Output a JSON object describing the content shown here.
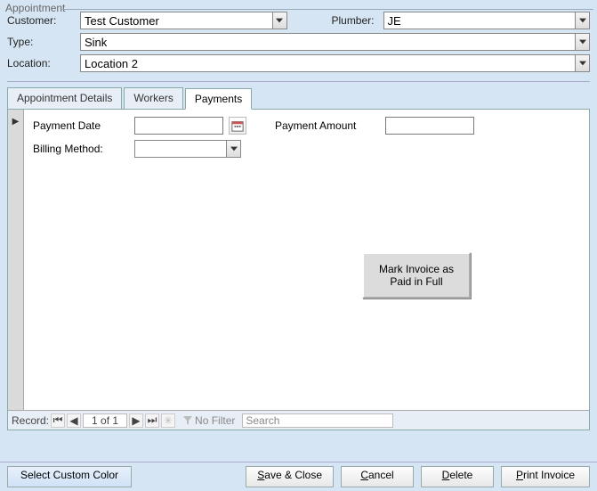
{
  "window_title": "Appointment",
  "header": {
    "customer_label": "Customer:",
    "customer_value": "Test Customer",
    "plumber_label": "Plumber:",
    "plumber_value": "JE",
    "type_label": "Type:",
    "type_value": "Sink",
    "location_label": "Location:",
    "location_value": "Location 2"
  },
  "tabs": {
    "t0": "Appointment Details",
    "t1": "Workers",
    "t2": "Payments",
    "active": 2
  },
  "payments": {
    "payment_date_label": "Payment Date",
    "payment_date_value": "",
    "payment_amount_label": "Payment Amount",
    "payment_amount_value": "",
    "billing_method_label": "Billing Method:",
    "billing_method_value": "",
    "mark_paid_button": "Mark Invoice as\nPaid in Full"
  },
  "record_nav": {
    "label": "Record:",
    "position": "1 of 1",
    "no_filter": "No Filter",
    "search_placeholder": "Search"
  },
  "footer": {
    "select_color": "Select Custom Color",
    "save_close": "Save & Close",
    "cancel": "Cancel",
    "delete": "Delete",
    "print_invoice": "Print Invoice"
  }
}
